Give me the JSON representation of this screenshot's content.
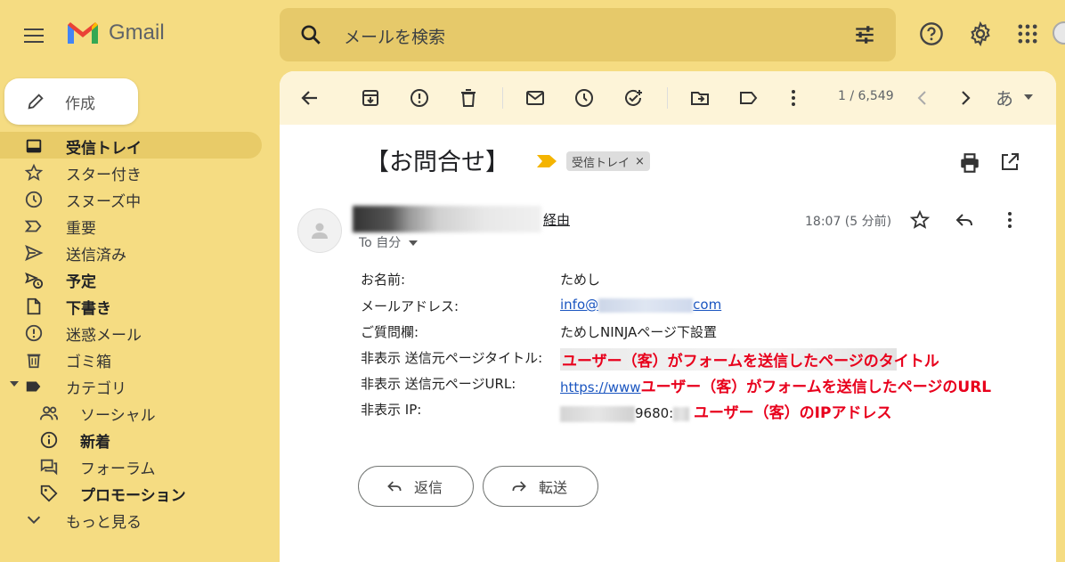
{
  "header": {
    "app_name": "Gmail",
    "search_placeholder": "メールを検索"
  },
  "sidebar": {
    "compose_label": "作成",
    "items": [
      {
        "label": "受信トレイ",
        "icon": "inbox-icon"
      },
      {
        "label": "スター付き",
        "icon": "star-icon"
      },
      {
        "label": "スヌーズ中",
        "icon": "clock-icon"
      },
      {
        "label": "重要",
        "icon": "label-important-icon"
      },
      {
        "label": "送信済み",
        "icon": "send-icon"
      },
      {
        "label": "予定",
        "icon": "scheduled-icon"
      },
      {
        "label": "下書き",
        "icon": "draft-icon"
      },
      {
        "label": "迷惑メール",
        "icon": "spam-icon"
      },
      {
        "label": "ゴミ箱",
        "icon": "trash-icon"
      },
      {
        "label": "カテゴリ",
        "icon": "label-icon"
      },
      {
        "label": "ソーシャル",
        "icon": "people-icon"
      },
      {
        "label": "新着",
        "icon": "info-icon"
      },
      {
        "label": "フォーラム",
        "icon": "forum-icon"
      },
      {
        "label": "プロモーション",
        "icon": "tag-icon"
      },
      {
        "label": "もっと見る",
        "icon": "chevron-down-icon"
      }
    ]
  },
  "toolbar": {
    "count": "1 / 6,549",
    "input_lang": "あ"
  },
  "message": {
    "subject": "【お問合せ】",
    "label_chip": "受信トレイ",
    "label_chip_close": "×",
    "via": "経由",
    "to": "To 自分",
    "time": "18:07 (5 分前)"
  },
  "form": {
    "rows": [
      {
        "key": "お名前:",
        "value": "ためし"
      },
      {
        "key": "メールアドレス:",
        "value_prefix": "info@",
        "value_suffix": "com"
      },
      {
        "key": "ご質問欄:",
        "value": "ためしNINJAページ下設置"
      },
      {
        "key": "非表示 送信元ページタイトル:",
        "annotation": "ユーザー（客）がフォームを送信したページのタイトル"
      },
      {
        "key": "非表示 送信元ページURL:",
        "value_prefix": "https://www",
        "annotation": "ユーザー（客）がフォームを送信したページのURL"
      },
      {
        "key": "非表示 IP:",
        "value_mid": "9680:",
        "annotation": "ユーザー（客）のIPアドレス"
      }
    ]
  },
  "actions": {
    "reply": "返信",
    "forward": "転送"
  },
  "colors": {
    "background": "#f5dc82",
    "search": "#e6c96a",
    "active_nav": "#e8cb68",
    "toolbar": "#fdf4d8",
    "annotation_red": "#e8001c",
    "link": "#1a55c0"
  }
}
